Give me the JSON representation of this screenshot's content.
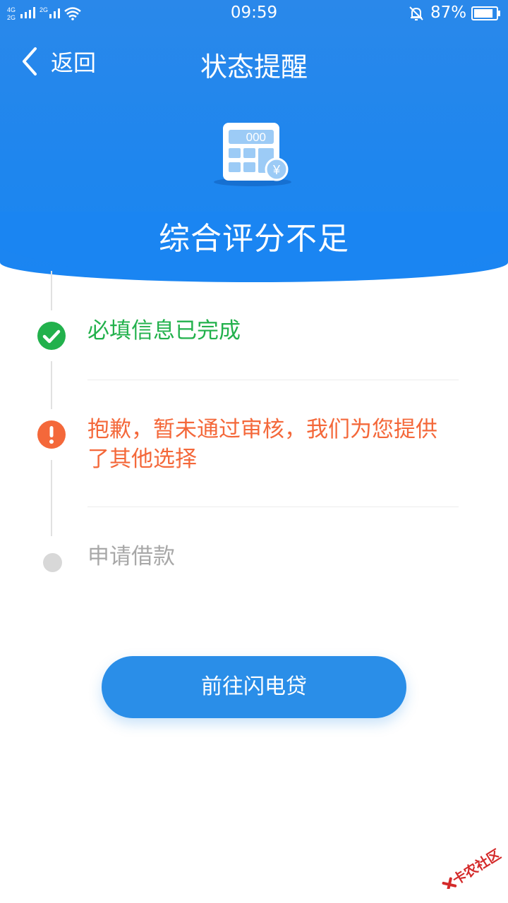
{
  "status_bar": {
    "time": "09:59",
    "battery_percent": "87%",
    "network_1": "4G",
    "network_2": "2G",
    "network_3": "2G",
    "battery_level": 0.87
  },
  "nav": {
    "back_label": "返回",
    "title": "状态提醒"
  },
  "hero": {
    "icon_display": "000",
    "currency_symbol": "¥",
    "title": "综合评分不足"
  },
  "steps": [
    {
      "text": "必填信息已完成",
      "status": "done",
      "color": "#22b14c"
    },
    {
      "text": "抱歉，暂未通过审核，我们为您提供了其他选择",
      "status": "error",
      "color": "#f4683a"
    },
    {
      "text": "申请借款",
      "status": "pending",
      "color": "#a8a8a8"
    }
  ],
  "cta": {
    "label": "前往闪电贷"
  },
  "watermark": {
    "text": "卡农社区"
  },
  "colors": {
    "header_blue": "#1e86ee",
    "button_blue": "#2a8ee8",
    "success_green": "#22b14c",
    "error_orange": "#f4683a",
    "pending_gray": "#d8d8d8"
  }
}
